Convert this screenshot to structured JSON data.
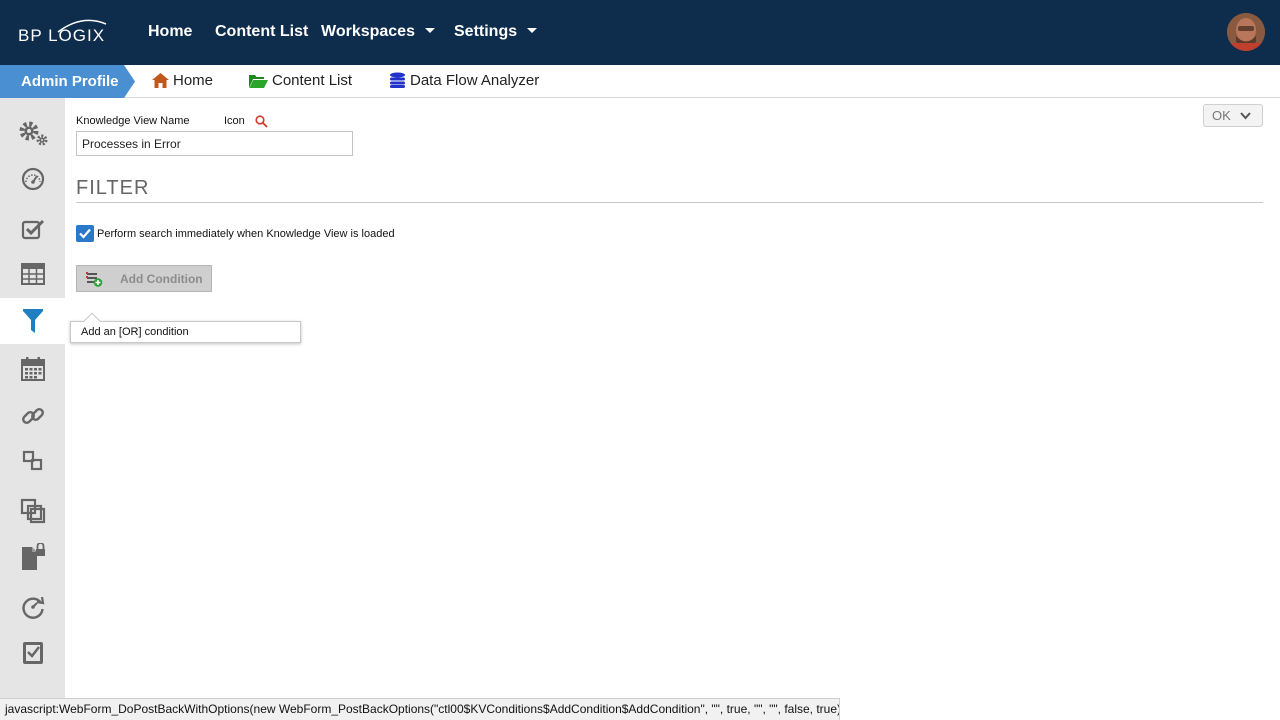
{
  "logo": {
    "text": "BP LOGIX"
  },
  "topnav": {
    "items": [
      {
        "label": "Home"
      },
      {
        "label": "Content List"
      },
      {
        "label": "Workspaces",
        "has_dropdown": true
      },
      {
        "label": "Settings",
        "has_dropdown": true
      }
    ]
  },
  "breadcrumb": {
    "current": "Admin Profile",
    "links": [
      {
        "label": "Home",
        "icon": "home-icon"
      },
      {
        "label": "Content List",
        "icon": "folder-open-icon"
      },
      {
        "label": "Data Flow Analyzer",
        "icon": "database-icon"
      }
    ]
  },
  "sidebar": {
    "items": [
      {
        "icon": "gears-icon"
      },
      {
        "icon": "dashboard-gauge-icon"
      },
      {
        "icon": "checkbox-edit-icon"
      },
      {
        "icon": "table-grid-icon"
      },
      {
        "icon": "filter-funnel-icon",
        "active": true
      },
      {
        "icon": "calendar-icon"
      },
      {
        "icon": "link-icon"
      },
      {
        "icon": "relation-icon"
      },
      {
        "icon": "clone-icon"
      },
      {
        "icon": "file-lock-icon"
      },
      {
        "icon": "refresh-gauge-icon"
      },
      {
        "icon": "clipboard-check-icon"
      }
    ]
  },
  "form": {
    "kv_name_label": "Knowledge View Name",
    "icon_label": "Icon",
    "kv_name_value": "Processes in Error",
    "ok_label": "OK"
  },
  "filter": {
    "heading": "FILTER",
    "perform_search_label": "Perform search immediately when Knowledge View is loaded",
    "perform_search_checked": true,
    "add_condition_label": "Add Condition",
    "tooltip_text": "Add an [OR] condition"
  },
  "statusbar": {
    "text": "javascript:WebForm_DoPostBackWithOptions(new WebForm_PostBackOptions(\"ctl00$KVConditions$AddCondition$AddCondition\", \"\", true, \"\", \"\", false, true))"
  },
  "colors": {
    "topnav_bg": "#0e2c4b",
    "crumb_accent": "#4a8fd1",
    "sidebar_bg": "#e5e5e5",
    "checkbox_blue": "#2b78c9",
    "icon_gray": "#666666",
    "filter_active_blue": "#1f7fc1"
  }
}
